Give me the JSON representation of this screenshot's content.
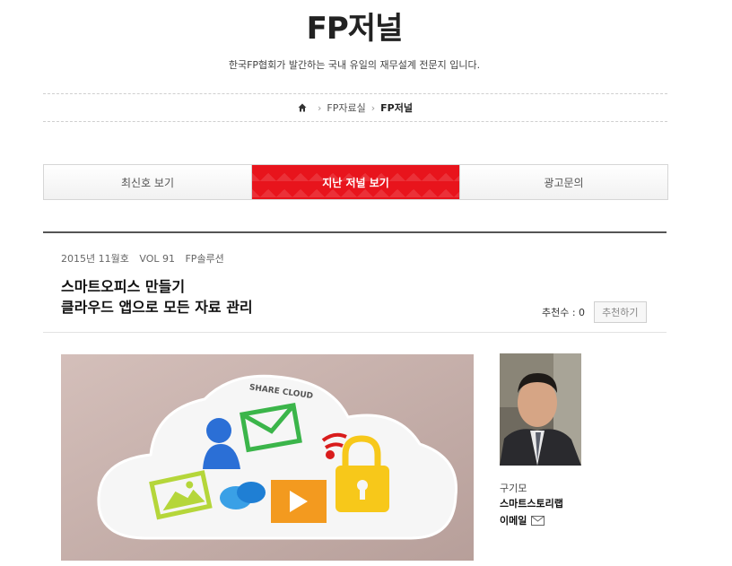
{
  "header": {
    "title": "FP저널",
    "description": "한국FP협회가 발간하는 국내 유일의 재무설계 전문지 입니다."
  },
  "breadcrumb": {
    "home_icon": "home-icon",
    "items": [
      "FP자료실",
      "FP저널"
    ]
  },
  "tabs": [
    {
      "label": "최신호 보기",
      "active": false
    },
    {
      "label": "지난 저널 보기",
      "active": true
    },
    {
      "label": "광고문의",
      "active": false
    }
  ],
  "article": {
    "issue": "2015년 11월호",
    "vol": "VOL 91",
    "category": "FP솔루션",
    "title_line1": "스마트오피스 만들기",
    "title_line2": "클라우드 앱으로 모든 자료 관리",
    "recommend_label": "추천수 : 0",
    "recommend_button": "추천하기",
    "hero_caption": "SHARE CLOUD"
  },
  "author": {
    "name": "구기모",
    "org": "스마트스토리랩",
    "email_label": "이메일",
    "email_icon": "envelope-icon"
  },
  "colors": {
    "accent": "#e8141c",
    "hero_bg": "#c7b0ab"
  }
}
